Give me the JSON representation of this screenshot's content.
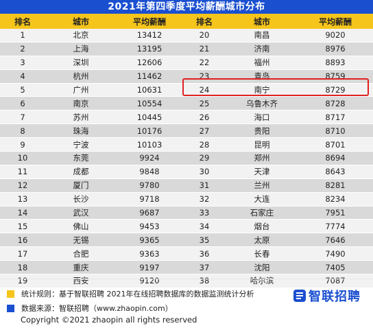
{
  "title": "2021年第四季度平均薪酬城市分布",
  "headers": [
    "排名",
    "城市",
    "平均薪酬",
    "排名",
    "城市",
    "平均薪酬"
  ],
  "rows": [
    [
      "1",
      "北京",
      "13412",
      "20",
      "南昌",
      "9020"
    ],
    [
      "2",
      "上海",
      "13195",
      "21",
      "济南",
      "8976"
    ],
    [
      "3",
      "深圳",
      "12606",
      "22",
      "福州",
      "8893"
    ],
    [
      "4",
      "杭州",
      "11462",
      "23",
      "青岛",
      "8759"
    ],
    [
      "5",
      "广州",
      "10631",
      "24",
      "南宁",
      "8729"
    ],
    [
      "6",
      "南京",
      "10554",
      "25",
      "乌鲁木齐",
      "8728"
    ],
    [
      "7",
      "苏州",
      "10445",
      "26",
      "海口",
      "8717"
    ],
    [
      "8",
      "珠海",
      "10176",
      "27",
      "贵阳",
      "8710"
    ],
    [
      "9",
      "宁波",
      "10103",
      "28",
      "昆明",
      "8701"
    ],
    [
      "10",
      "东莞",
      "9924",
      "29",
      "郑州",
      "8694"
    ],
    [
      "11",
      "成都",
      "9848",
      "30",
      "天津",
      "8643"
    ],
    [
      "12",
      "厦门",
      "9780",
      "31",
      "兰州",
      "8281"
    ],
    [
      "13",
      "长沙",
      "9718",
      "32",
      "大连",
      "8234"
    ],
    [
      "14",
      "武汉",
      "9687",
      "33",
      "石家庄",
      "7951"
    ],
    [
      "15",
      "佛山",
      "9453",
      "34",
      "烟台",
      "7774"
    ],
    [
      "16",
      "无锡",
      "9365",
      "35",
      "太原",
      "7646"
    ],
    [
      "17",
      "合肥",
      "9363",
      "36",
      "长春",
      "7490"
    ],
    [
      "18",
      "重庆",
      "9197",
      "37",
      "沈阳",
      "7405"
    ],
    [
      "19",
      "西安",
      "9120",
      "38",
      "哈尔滨",
      "7087"
    ]
  ],
  "highlighted_row_rank": "24",
  "notes": {
    "rule": "统计规则：基于智联招聘 2021年在线招聘数据库的数据监测统计分析",
    "source": "数据来源：智联招聘（www.zhaopin.com）"
  },
  "logo_text": "智联招聘",
  "copyright": "Copyright ©2021 zhaopin all rights reserved",
  "colors": {
    "title_bg": "#1a4fd0",
    "header_bg": "#f6c51b",
    "row_light": "#f2f2f2",
    "row_dark": "#d9d9d9",
    "highlight": "#e02020",
    "note_yellow": "#f6c51b",
    "note_blue": "#1a4fd0"
  }
}
